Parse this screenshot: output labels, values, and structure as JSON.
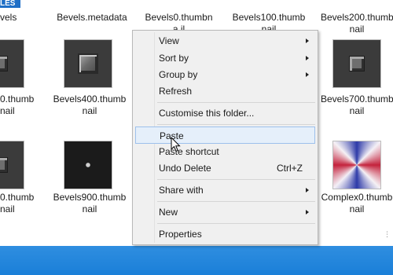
{
  "files": {
    "top_row": [
      {
        "label": "vels"
      },
      {
        "label": "Bevels.metadata"
      },
      {
        "label": "Bevels0.thumbna il"
      },
      {
        "label": "Bevels100.thumb nail"
      },
      {
        "label": "Bevels200.thumb nail"
      }
    ],
    "mid_row": [
      {
        "label": "0.thumb nail"
      },
      {
        "label": "Bevels400.thumb nail"
      },
      {
        "label": "Bevels700.thumb nail"
      }
    ],
    "bottom_row": [
      {
        "label": "0.thumb nail"
      },
      {
        "label": "Bevels900.thumb nail"
      },
      {
        "label": "Complex0.thumb nail"
      }
    ],
    "partial_badge": "LES"
  },
  "context_menu": {
    "view": "View",
    "sort_by": "Sort by",
    "group_by": "Group by",
    "refresh": "Refresh",
    "customise": "Customise this folder...",
    "paste": "Paste",
    "paste_shortcut": "Paste shortcut",
    "undo_delete": "Undo Delete",
    "undo_delete_shortcut": "Ctrl+Z",
    "share_with": "Share with",
    "new": "New",
    "properties": "Properties"
  },
  "colors": {
    "taskbar": "#1a7fd8",
    "menu_bg": "#f0f0f0",
    "highlight": "#e5effa"
  }
}
